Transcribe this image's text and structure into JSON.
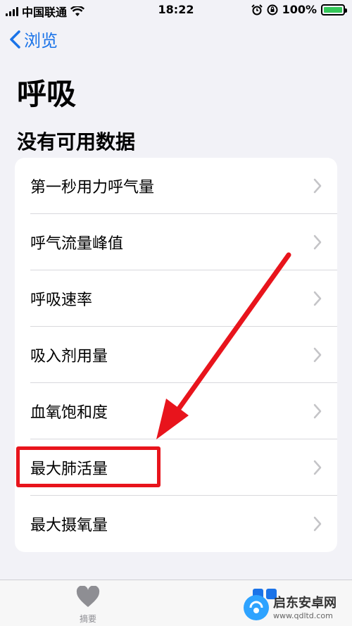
{
  "status_bar": {
    "carrier": "中国联通",
    "time": "18:22",
    "battery": "100%"
  },
  "nav": {
    "back_label": "浏览"
  },
  "page": {
    "title": "呼吸",
    "section_title": "没有可用数据"
  },
  "list": {
    "items": [
      {
        "label": "第一秒用力呼气量"
      },
      {
        "label": "呼气流量峰值"
      },
      {
        "label": "呼吸速率"
      },
      {
        "label": "吸入剂用量"
      },
      {
        "label": "血氧饱和度"
      },
      {
        "label": "最大肺活量"
      },
      {
        "label": "最大摄氧量"
      }
    ]
  },
  "tab_bar": {
    "summary_label": "摘要"
  },
  "watermark": {
    "title": "启东安卓网",
    "url": "www.qdltd.com"
  },
  "colors": {
    "accent": "#1a73e8",
    "annotation": "#e8141c"
  }
}
